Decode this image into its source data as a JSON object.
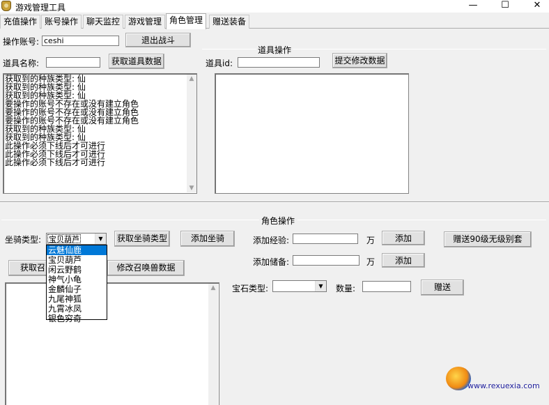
{
  "window": {
    "title": "游戏管理工具",
    "minimize": "—",
    "maximize": "☐",
    "close": "✕"
  },
  "tabs": [
    {
      "label": "充值操作"
    },
    {
      "label": "账号操作"
    },
    {
      "label": "聊天监控"
    },
    {
      "label": "游戏管理"
    },
    {
      "label": "角色管理"
    },
    {
      "label": "赠送装备"
    }
  ],
  "account": {
    "label": "操作账号:",
    "value": "ceshi",
    "exit_battle_button": "退出战斗"
  },
  "item_ops": {
    "item_name_label": "道具名称:",
    "item_name_value": "",
    "get_item_data_button": "获取道具数据",
    "group_title": "道具操作",
    "item_id_label": "道具id:",
    "item_id_value": "",
    "submit_button": "提交修改数据",
    "log_lines": [
      "获取到的种族类型: 仙",
      "获取到的种族类型: 仙",
      "获取到的种族类型: 仙",
      "要操作的账号不存在或没有建立角色",
      "要操作的账号不存在或没有建立角色",
      "要操作的账号不存在或没有建立角色",
      "获取到的种族类型: 仙",
      "获取到的种族类型: 仙",
      "此操作必须下线后才可进行",
      "此操作必须下线后才可进行",
      "此操作必须下线后才可进行"
    ]
  },
  "role_ops": {
    "group_title": "角色操作",
    "mount_type_label": "坐骑类型:",
    "mount_selected": "宝贝葫芦",
    "mount_options": [
      "云魅仙鹿",
      "宝贝葫芦",
      "闲云野鹤",
      "神气小龟",
      "金麟仙子",
      "九尾神狐",
      "九霄冰凤",
      "银色穷奇"
    ],
    "mount_highlighted_index": 0,
    "get_mount_type_button": "获取坐骑类型",
    "add_mount_button": "添加坐骑",
    "get_summon_button": "获取召",
    "modify_summon_button": "修改召唤兽数据",
    "add_exp_label": "添加经验:",
    "add_exp_value": "",
    "exp_unit": "万",
    "add_exp_button": "添加",
    "add_storage_label": "添加储备:",
    "add_storage_value": "",
    "storage_unit": "万",
    "add_storage_button": "添加",
    "gift_set_button": "赠送90级无级别套",
    "gem_type_label": "宝石类型:",
    "gem_type_value": "",
    "quantity_label": "数量:",
    "quantity_value": "",
    "gift_button": "赠送"
  },
  "watermark": {
    "text": "www.rexuexia.com"
  },
  "colors": {
    "selection": "#0078d7",
    "window_bg": "#f0f0f0"
  }
}
